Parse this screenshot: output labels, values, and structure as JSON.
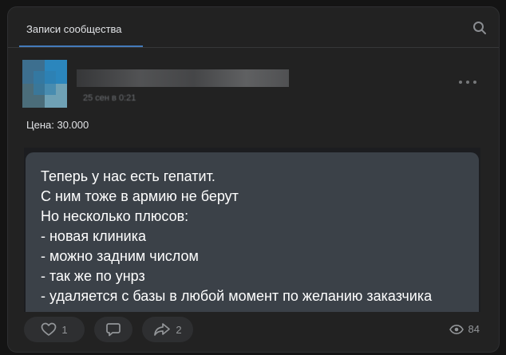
{
  "tabs": {
    "active_label": "Записи сообщества"
  },
  "icons": {
    "search": "search-icon",
    "more": "more-horizontal-icon",
    "like": "heart-icon",
    "comment": "comment-icon",
    "share": "share-icon",
    "views": "eye-icon"
  },
  "post": {
    "date": "25 сен в 0:21",
    "price_text": "Цена: 30.000",
    "message_lines": [
      "Теперь у нас есть гепатит.",
      "С ним тоже в армию не берут",
      "Но несколько плюсов:",
      "- новая клиника",
      "- можно задним числом",
      "- так же по унрз",
      "- удаляется с базы в любой момент по желанию заказчика"
    ],
    "likes": "1",
    "shares": "2",
    "views": "84"
  },
  "colors": {
    "background": "#141414",
    "card": "#222222",
    "accent": "#447bba",
    "bubble": "#3b4148",
    "muted": "#939699"
  }
}
